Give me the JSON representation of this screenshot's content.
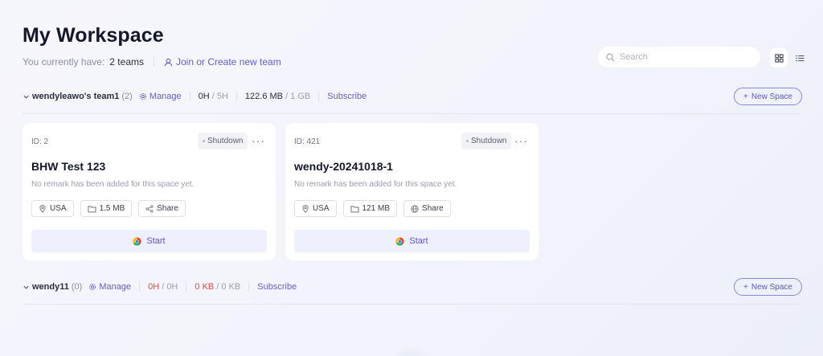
{
  "page": {
    "title": "My Workspace",
    "subtitle_prefix": "You currently have:",
    "team_count": "2 teams",
    "join_label": "Join or Create new team"
  },
  "search": {
    "placeholder": "Search",
    "value": ""
  },
  "view_toggle": {
    "grid_icon": "grid-icon",
    "list_icon": "list-icon",
    "active": "grid"
  },
  "teams": [
    {
      "name": "wendyleawo's team1",
      "members": "(2)",
      "manage_label": "Manage",
      "hours_used": "0H",
      "hours_total": "/ 5H",
      "storage_used": "122.6 MB",
      "storage_total": "/ 1 GB",
      "subscribe_label": "Subscribe",
      "new_space_label": "New Space",
      "spaces": [
        {
          "id": "ID: 2",
          "status": "Shutdown",
          "more": "···",
          "name": "BHW Test 123",
          "remark": "No remark has been added for this space yet.",
          "region": "USA",
          "size": "1.5 MB",
          "share": "Share",
          "start_label": "Start"
        },
        {
          "id": "ID: 421",
          "status": "Shutdown",
          "more": "···",
          "name": "wendy-20241018-1",
          "remark": "No remark has been added for this space yet.",
          "region": "USA",
          "size": "121 MB",
          "share": "Share",
          "start_label": "Start"
        }
      ]
    },
    {
      "name": "wendy11",
      "members": "(0)",
      "manage_label": "Manage",
      "hours_used": "0H",
      "hours_total": "/ 0H",
      "storage_used": "0 KB",
      "storage_total": "/ 0 KB",
      "subscribe_label": "Subscribe",
      "new_space_label": "New Space",
      "spaces": []
    }
  ],
  "colors": {
    "accent": "#6360c8",
    "warning": "#e5483f",
    "start_bg": "#eef0fd"
  }
}
